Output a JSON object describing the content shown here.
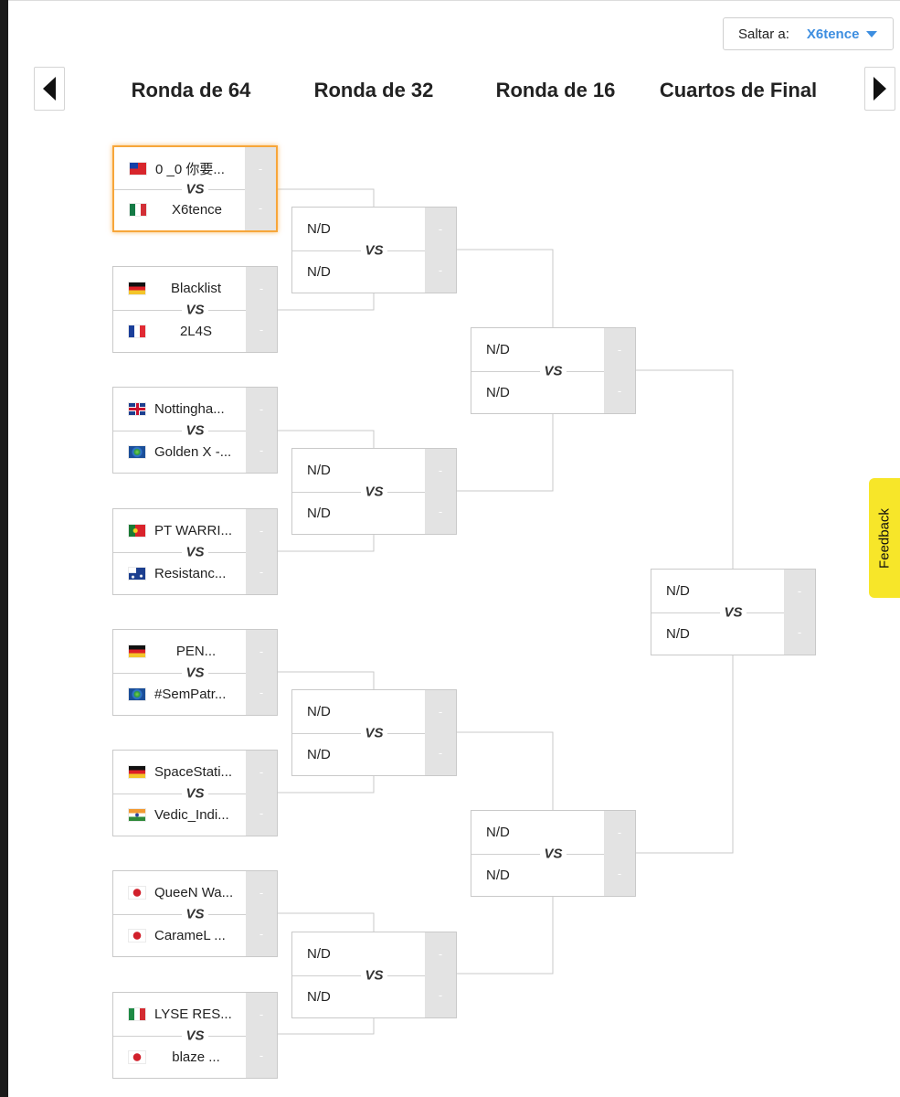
{
  "jump": {
    "label": "Saltar a:",
    "value": "X6tence"
  },
  "rounds": [
    "Ronda de 64",
    "Ronda de 32",
    "Ronda de 16",
    "Cuartos de Final"
  ],
  "vs_label": "VS",
  "score_placeholder": "-",
  "feedback": "Feedback",
  "highlight_color": "#f7a63a",
  "r64": [
    {
      "team1": {
        "name": "0 _0 你要...",
        "flag": "tw"
      },
      "team2": {
        "name": "X6tence",
        "flag": "mx"
      },
      "highlighted": true
    },
    {
      "team1": {
        "name": "Blacklist",
        "flag": "de"
      },
      "team2": {
        "name": "2L4S",
        "flag": "fr"
      }
    },
    {
      "team1": {
        "name": "Nottingha...",
        "flag": "gb"
      },
      "team2": {
        "name": "Golden X -...",
        "flag": "world"
      }
    },
    {
      "team1": {
        "name": "PT WARRI...",
        "flag": "pt"
      },
      "team2": {
        "name": "Resistanc...",
        "flag": "au"
      }
    },
    {
      "team1": {
        "name": "PEN...",
        "flag": "de"
      },
      "team2": {
        "name": "#SemPatr...",
        "flag": "world"
      }
    },
    {
      "team1": {
        "name": "SpaceStati...",
        "flag": "de"
      },
      "team2": {
        "name": "Vedic_Indi...",
        "flag": "in"
      }
    },
    {
      "team1": {
        "name": "QueeN Wa...",
        "flag": "jp"
      },
      "team2": {
        "name": "CarameL ...",
        "flag": "jp"
      }
    },
    {
      "team1": {
        "name": "LYSE RES...",
        "flag": "it"
      },
      "team2": {
        "name": "blaze ...",
        "flag": "jp"
      }
    }
  ],
  "r32": [
    {
      "team1": "N/D",
      "team2": "N/D"
    },
    {
      "team1": "N/D",
      "team2": "N/D"
    },
    {
      "team1": "N/D",
      "team2": "N/D"
    },
    {
      "team1": "N/D",
      "team2": "N/D"
    }
  ],
  "r16": [
    {
      "team1": "N/D",
      "team2": "N/D"
    },
    {
      "team1": "N/D",
      "team2": "N/D"
    }
  ],
  "qf": [
    {
      "team1": "N/D",
      "team2": "N/D"
    }
  ]
}
